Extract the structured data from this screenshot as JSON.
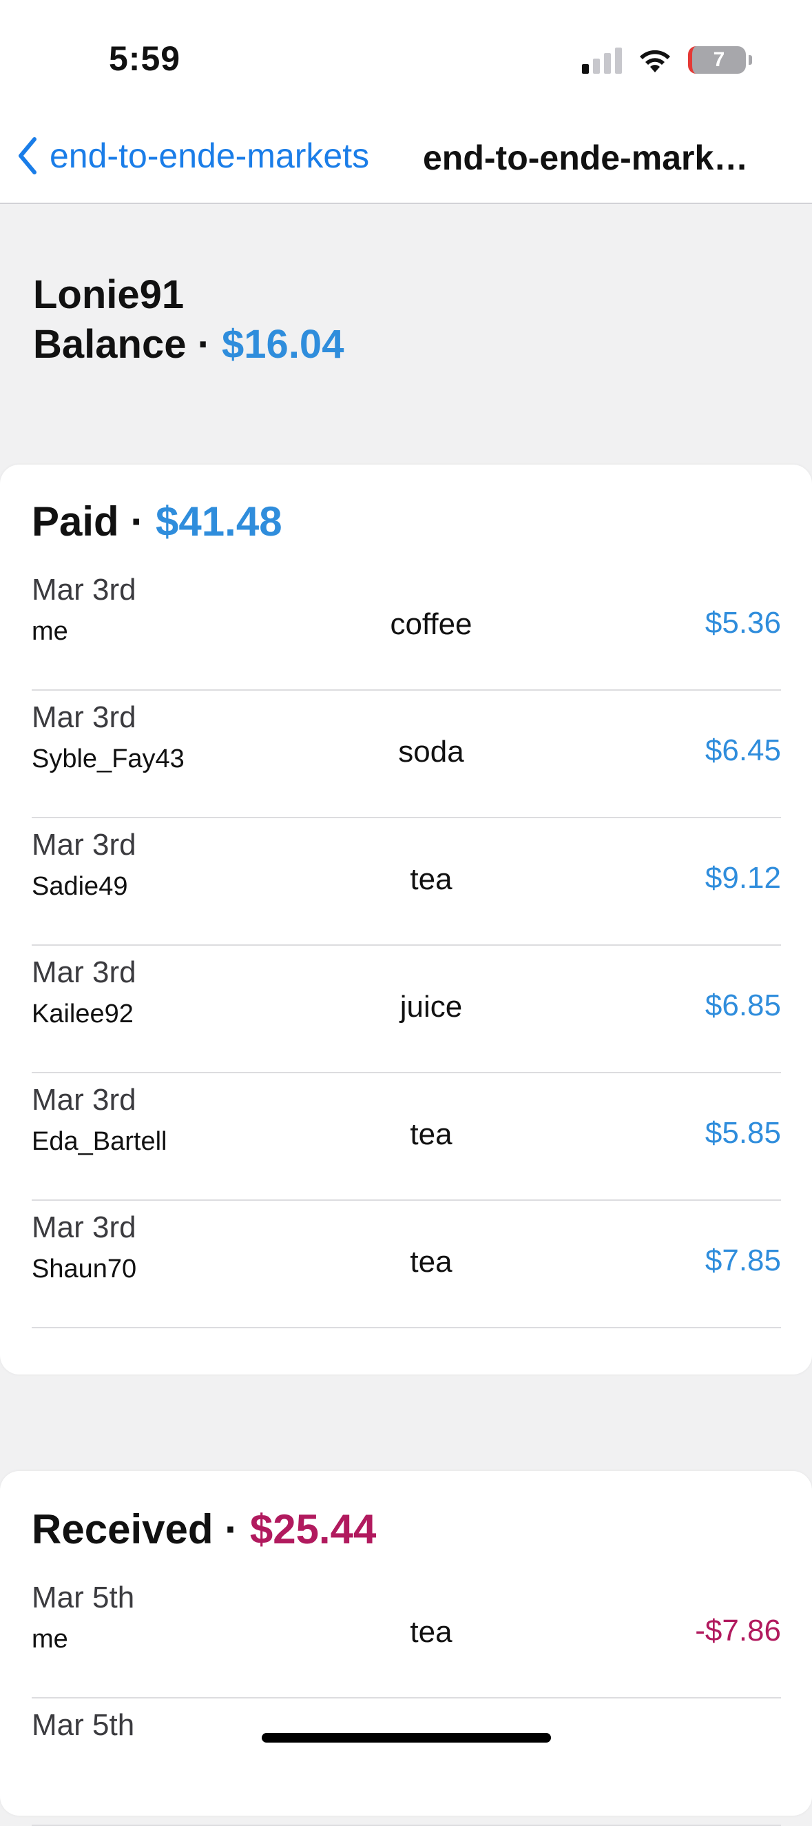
{
  "status_bar": {
    "time": "5:59",
    "battery_level": "7",
    "signal_bars_active": 1,
    "signal_bars_total": 4
  },
  "nav": {
    "back_label": "end-to-ende-markets",
    "title": "end-to-ende-mark…"
  },
  "header": {
    "user": "Lonie91",
    "balance_label": "Balance",
    "separator": "·",
    "balance_value": "$16.04"
  },
  "paid": {
    "label": "Paid",
    "separator": "·",
    "total": "$41.48",
    "rows": [
      {
        "date": "Mar 3rd",
        "who": "me",
        "item": "coffee",
        "amount": "$5.36"
      },
      {
        "date": "Mar 3rd",
        "who": "Syble_Fay43",
        "item": "soda",
        "amount": "$6.45"
      },
      {
        "date": "Mar 3rd",
        "who": "Sadie49",
        "item": "tea",
        "amount": "$9.12"
      },
      {
        "date": "Mar 3rd",
        "who": "Kailee92",
        "item": "juice",
        "amount": "$6.85"
      },
      {
        "date": "Mar 3rd",
        "who": "Eda_Bartell",
        "item": "tea",
        "amount": "$5.85"
      },
      {
        "date": "Mar 3rd",
        "who": "Shaun70",
        "item": "tea",
        "amount": "$7.85"
      }
    ]
  },
  "received": {
    "label": "Received",
    "separator": "·",
    "total": "$25.44",
    "rows": [
      {
        "date": "Mar 5th",
        "who": "me",
        "item": "tea",
        "amount": "-$7.86"
      },
      {
        "date": "Mar 5th",
        "who": "",
        "item": "",
        "amount": ""
      }
    ]
  },
  "colors": {
    "accent_blue": "#2f8ddc",
    "link_blue": "#1a7de8",
    "received_magenta": "#b11a5e",
    "background": "#f1f1f2"
  }
}
